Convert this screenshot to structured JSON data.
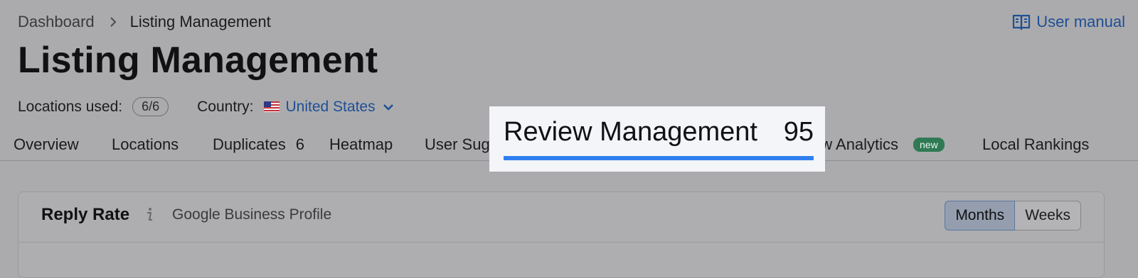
{
  "breadcrumb": {
    "parent": "Dashboard",
    "current": "Listing Management"
  },
  "header": {
    "title": "Listing Management",
    "manual_label": "User manual"
  },
  "meta": {
    "locations_label": "Locations used:",
    "locations_value": "6/6",
    "country_label": "Country:",
    "country_value": "United States"
  },
  "tabs": [
    {
      "label": "Overview"
    },
    {
      "label": "Locations"
    },
    {
      "label": "Duplicates",
      "count": "6"
    },
    {
      "label": "Heatmap"
    },
    {
      "label": "User Sug"
    },
    {
      "label": "ew Analytics",
      "badge": "new"
    },
    {
      "label": "Local Rankings"
    }
  ],
  "highlight": {
    "label": "Review Management",
    "count": "95"
  },
  "card": {
    "title": "Reply Rate",
    "subtitle": "Google Business Profile",
    "toggle": [
      "Months",
      "Weeks"
    ],
    "active_toggle": "Months"
  },
  "colors": {
    "link": "#1f4f95",
    "accent": "#2f7ff0",
    "new_badge": "#2f7a55"
  }
}
